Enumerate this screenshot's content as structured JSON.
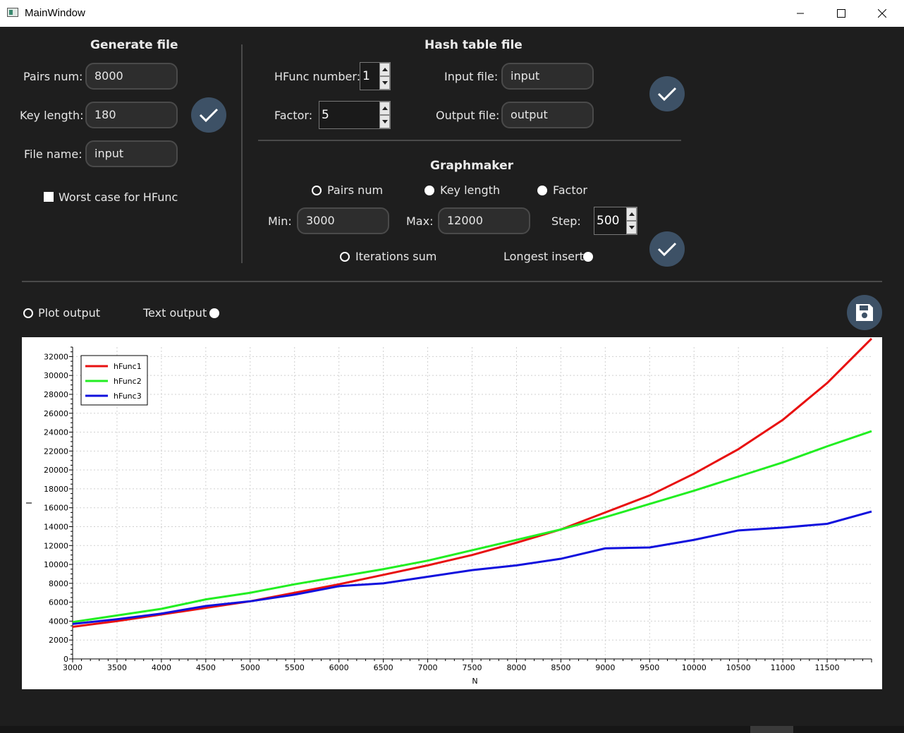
{
  "window": {
    "title": "MainWindow"
  },
  "generate": {
    "title": "Generate file",
    "pairs_label": "Pairs num:",
    "pairs_value": "8000",
    "key_label": "Key length:",
    "key_value": "180",
    "file_label": "File name:",
    "file_value": "input",
    "worst_case_label": "Worst case for HFunc",
    "worst_case_checked": true
  },
  "hash": {
    "title": "Hash table file",
    "hfunc_label": "HFunc number:",
    "hfunc_value": "1",
    "factor_label": "Factor:",
    "factor_value": "5",
    "input_label": "Input file:",
    "input_value": "input",
    "output_label": "Output file:",
    "output_value": "output"
  },
  "graph": {
    "title": "Graphmaker",
    "radio_pairs": "Pairs num",
    "radio_key": "Key length",
    "radio_factor": "Factor",
    "selected_param": "pairs_num",
    "min_label": "Min:",
    "min_value": "3000",
    "max_label": "Max:",
    "max_value": "12000",
    "step_label": "Step:",
    "step_value": "500",
    "metric_iter": "Iterations sum",
    "metric_longest": "Longest insert",
    "selected_metric": "iterations_sum"
  },
  "output": {
    "plot_label": "Plot output",
    "text_label": "Text output",
    "selected": "plot"
  },
  "icons": {
    "confirm": "checkmark-icon",
    "save": "floppy-disk-icon"
  },
  "colors": {
    "background": "#1e1e1e",
    "button": "#3d5166",
    "field": "#2d2d2d"
  },
  "chart_data": {
    "type": "line",
    "xlabel": "N",
    "ylabel": "I",
    "xlim": [
      3000,
      12000
    ],
    "ylim": [
      0,
      33000
    ],
    "x_ticks": [
      3000,
      3500,
      4000,
      4500,
      5000,
      5500,
      6000,
      6500,
      7000,
      7500,
      8000,
      8500,
      9000,
      9500,
      10000,
      10500,
      11000,
      11500
    ],
    "y_ticks": [
      0,
      2000,
      4000,
      6000,
      8000,
      10000,
      12000,
      14000,
      16000,
      18000,
      20000,
      22000,
      24000,
      26000,
      28000,
      30000,
      32000
    ],
    "grid": true,
    "legend_position": "top-left",
    "x": [
      3000,
      3500,
      4000,
      4500,
      5000,
      5500,
      6000,
      6500,
      7000,
      7500,
      8000,
      8500,
      9000,
      9500,
      10000,
      10500,
      11000,
      11500,
      12000
    ],
    "series": [
      {
        "name": "hFunc1",
        "color": "#e81010",
        "values": [
          3400,
          4000,
          4700,
          5400,
          6100,
          7000,
          7900,
          8900,
          9900,
          11000,
          12300,
          13700,
          15500,
          17300,
          19600,
          22200,
          25300,
          29200,
          33900
        ]
      },
      {
        "name": "hFunc2",
        "color": "#22ee22",
        "values": [
          3900,
          4600,
          5300,
          6300,
          7000,
          7900,
          8700,
          9500,
          10400,
          11500,
          12600,
          13700,
          15000,
          16400,
          17800,
          19300,
          20800,
          22500,
          24100
        ]
      },
      {
        "name": "hFunc3",
        "color": "#1010dd",
        "values": [
          3700,
          4200,
          4800,
          5600,
          6100,
          6800,
          7700,
          8000,
          8700,
          9400,
          9900,
          10600,
          11700,
          11800,
          12600,
          13600,
          13900,
          14300,
          15600
        ]
      }
    ]
  }
}
